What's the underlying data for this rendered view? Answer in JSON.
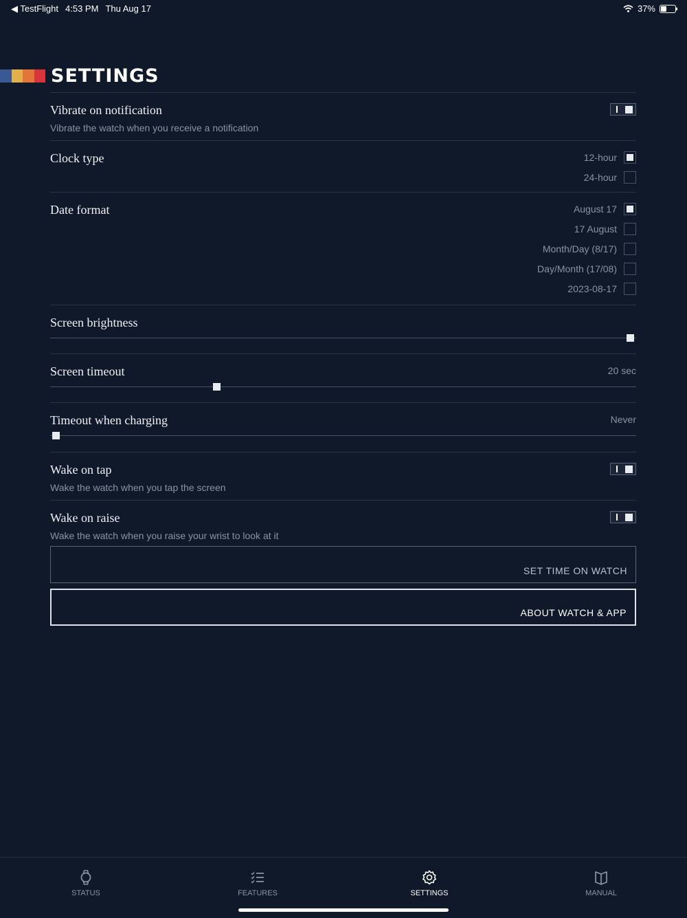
{
  "status": {
    "back_app": "◀ TestFlight",
    "time": "4:53 PM",
    "date": "Thu Aug 17",
    "battery": "37%"
  },
  "colors": {
    "background": "#0f1929",
    "stripes": [
      "#3a5894",
      "#e2b04a",
      "#e3753a",
      "#d8343c"
    ]
  },
  "page": {
    "title": "SETTINGS"
  },
  "settings": {
    "vibrate": {
      "title": "Vibrate on notification",
      "subtitle": "Vibrate the watch when you receive a notification",
      "enabled": true
    },
    "clock_type": {
      "title": "Clock type",
      "options": [
        {
          "label": "12-hour",
          "checked": true
        },
        {
          "label": "24-hour",
          "checked": false
        }
      ]
    },
    "date_format": {
      "title": "Date format",
      "options": [
        {
          "label": "August 17",
          "checked": true
        },
        {
          "label": "17 August",
          "checked": false
        },
        {
          "label": "Month/Day (8/17)",
          "checked": false
        },
        {
          "label": "Day/Month (17/08)",
          "checked": false
        },
        {
          "label": "2023-08-17",
          "checked": false
        }
      ]
    },
    "brightness": {
      "title": "Screen brightness",
      "level": 1.0
    },
    "timeout": {
      "title": "Screen timeout",
      "value": "20 sec",
      "level": 0.28
    },
    "charging_timeout": {
      "title": "Timeout when charging",
      "value": "Never",
      "level": 0.0
    },
    "wake_tap": {
      "title": "Wake on tap",
      "subtitle": "Wake the watch when you tap the screen",
      "enabled": true
    },
    "wake_raise": {
      "title": "Wake on raise",
      "subtitle": "Wake the watch when you raise your wrist to look at it",
      "enabled": true
    }
  },
  "buttons": {
    "set_time": "SET TIME ON WATCH",
    "about": "ABOUT WATCH & APP"
  },
  "tabs": [
    {
      "label": "STATUS",
      "icon": "watch-icon",
      "active": false
    },
    {
      "label": "FEATURES",
      "icon": "checklist-icon",
      "active": false
    },
    {
      "label": "SETTINGS",
      "icon": "gear-icon",
      "active": true
    },
    {
      "label": "MANUAL",
      "icon": "book-icon",
      "active": false
    }
  ]
}
